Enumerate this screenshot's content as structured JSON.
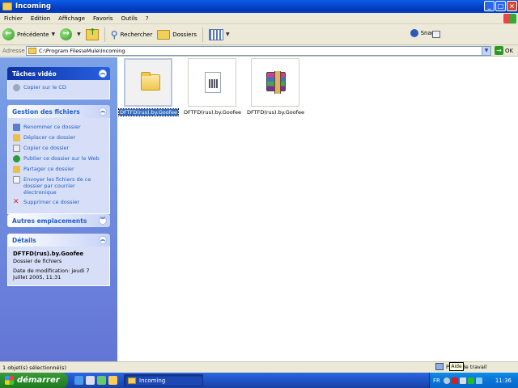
{
  "window": {
    "title": "Incoming"
  },
  "menu": {
    "items": [
      "Fichier",
      "Edition",
      "Affichage",
      "Favoris",
      "Outils",
      "?"
    ]
  },
  "toolbar": {
    "back_label": "Précédente",
    "search_label": "Rechercher",
    "folders_label": "Dossiers",
    "snagit_label": "SnagIt"
  },
  "address": {
    "label": "Adresse",
    "path": "C:\\Program Files\\eMule\\Incoming",
    "go_label": "OK"
  },
  "sidebar": {
    "video_tasks": {
      "title": "Tâches vidéo",
      "items": [
        "Copier sur le CD"
      ]
    },
    "file_tasks": {
      "title": "Gestion des fichiers",
      "items": [
        "Renommer ce dossier",
        "Déplacer ce dossier",
        "Copier ce dossier",
        "Publier ce dossier sur le Web",
        "Partager ce dossier",
        "Envoyer les fichiers de ce dossier par courrier électronique",
        "Supprimer ce dossier"
      ]
    },
    "other_places": {
      "title": "Autres emplacements"
    },
    "details": {
      "title": "Détails",
      "name": "DFTFD(rus).by.Goofee",
      "type": "Dossier de fichiers",
      "modified": "Date de modification: jeudi 7 juillet 2005, 11:31"
    }
  },
  "files": [
    {
      "name": "DFTFD(rus).by.Goofee",
      "kind": "folder",
      "selected": true
    },
    {
      "name": "DFTFD(rus).by.Goofee",
      "kind": "document",
      "selected": false
    },
    {
      "name": "DFTFD(rus).by.Goofee",
      "kind": "rar-archive",
      "selected": false
    }
  ],
  "status": {
    "left": "1 objet(s) sélectionné(s)",
    "right": "Poste de travail",
    "tooltip": "Aide"
  },
  "taskbar": {
    "start_label": "démarrer",
    "task_label": "Incoming",
    "language": "FR",
    "clock": "11:36"
  }
}
